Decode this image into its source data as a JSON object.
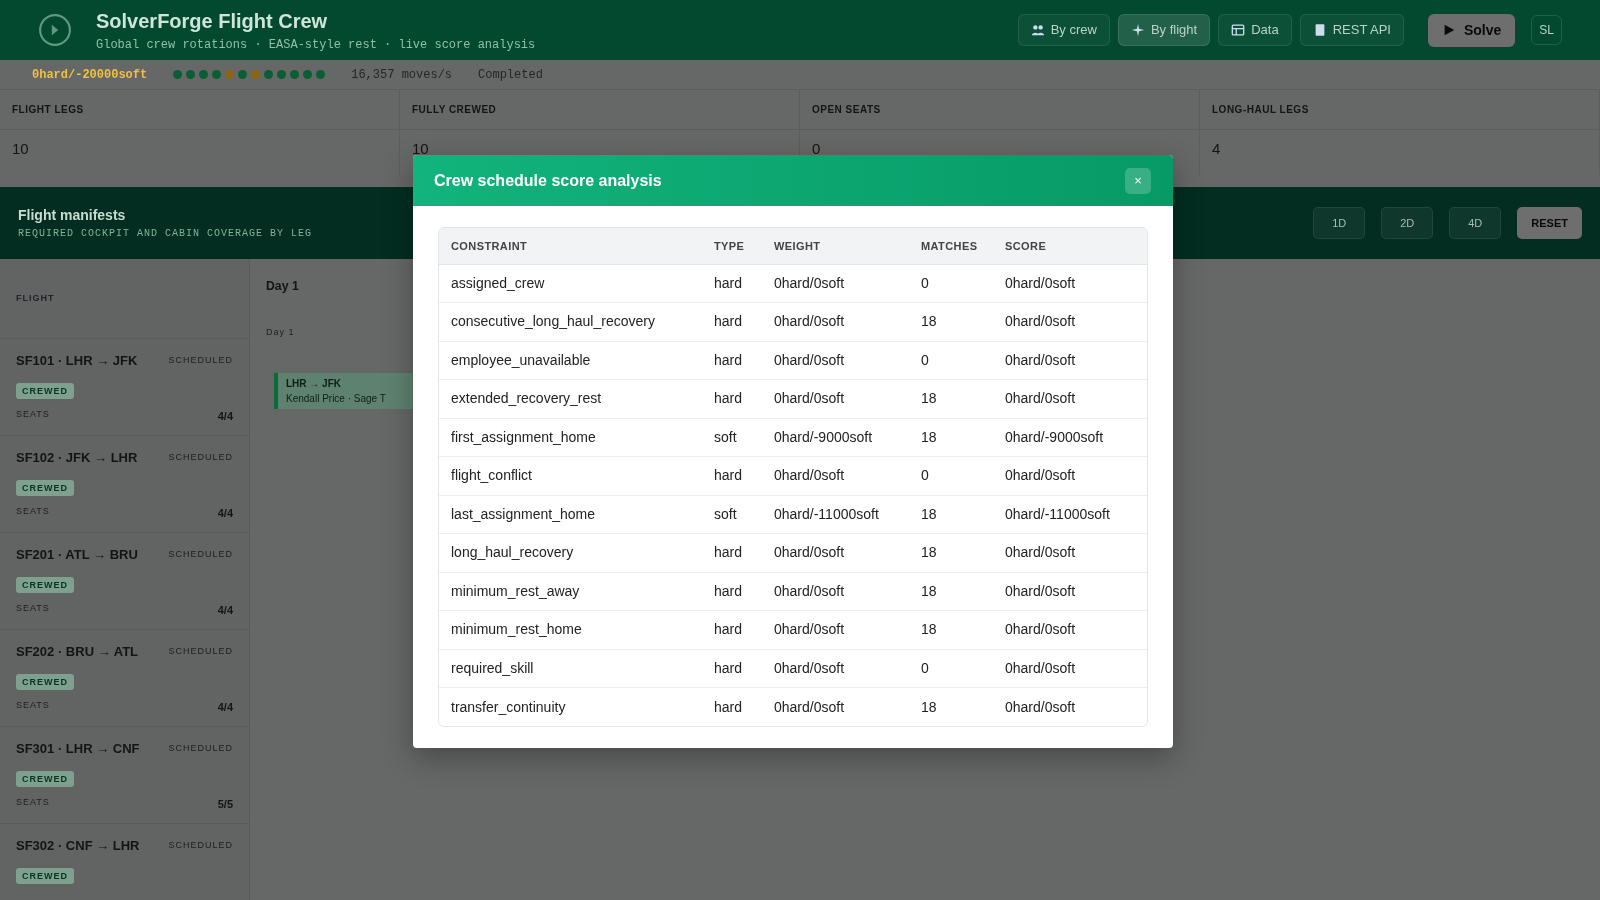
{
  "header": {
    "title": "SolverForge Flight Crew",
    "subtitle": "Global crew rotations · EASA-style rest · live score analysis",
    "nav": [
      {
        "kind": "crew",
        "label": "By crew",
        "selected": false
      },
      {
        "kind": "flight",
        "label": "By flight",
        "selected": true
      },
      {
        "kind": "data",
        "label": "Data",
        "selected": false
      },
      {
        "kind": "api",
        "label": "REST API",
        "selected": false
      }
    ],
    "solve_button": "Solve",
    "user_button": "SL"
  },
  "status": {
    "score": "0hard/-20000soft",
    "dots": [
      {
        "color": "#0b5e33"
      },
      {
        "color": "#0b5e33"
      },
      {
        "color": "#0b5e33"
      },
      {
        "color": "#0b5e33"
      },
      {
        "color": "#8a6512"
      },
      {
        "color": "#0b5e33"
      },
      {
        "color": "#8a6512"
      },
      {
        "color": "#0b5e33"
      },
      {
        "color": "#0b5e33"
      },
      {
        "color": "#0b5e33"
      },
      {
        "color": "#0b5e33"
      },
      {
        "color": "#0b5e33"
      }
    ],
    "speed": "16,357 moves/s",
    "state": "Completed"
  },
  "stats": [
    {
      "label": "FLIGHT LEGS",
      "value": "10"
    },
    {
      "label": "FULLY CREWED",
      "value": "10"
    },
    {
      "label": "OPEN SEATS",
      "value": "0"
    },
    {
      "label": "LONG-HAUL LEGS",
      "value": "4"
    }
  ],
  "manifest": {
    "title": "Flight manifests",
    "subtitle": "REQUIRED COCKPIT AND CABIN COVERAGE BY LEG",
    "zoom_buttons": [
      "1D",
      "2D",
      "4D"
    ],
    "reset": "RESET",
    "column_header": "FLIGHT",
    "day_header": "Day 1",
    "day_sub": "Day 1",
    "flights": [
      {
        "code": "SF101 · LHR → JFK",
        "status": "SCHEDULED",
        "badge": "CREWED",
        "seats_label": "SEATS",
        "seats": "4/4"
      },
      {
        "code": "SF102 · JFK → LHR",
        "status": "SCHEDULED",
        "badge": "CREWED",
        "seats_label": "SEATS",
        "seats": "4/4"
      },
      {
        "code": "SF201 · ATL → BRU",
        "status": "SCHEDULED",
        "badge": "CREWED",
        "seats_label": "SEATS",
        "seats": "4/4"
      },
      {
        "code": "SF202 · BRU → ATL",
        "status": "SCHEDULED",
        "badge": "CREWED",
        "seats_label": "SEATS",
        "seats": "4/4"
      },
      {
        "code": "SF301 · LHR → CNF",
        "status": "SCHEDULED",
        "badge": "CREWED",
        "seats_label": "SEATS",
        "seats": "5/5"
      },
      {
        "code": "SF302 · CNF → LHR",
        "status": "SCHEDULED",
        "badge": "CREWED"
      }
    ],
    "bar": {
      "route": "LHR → JFK",
      "crew": "Kendall Price · Sage T"
    }
  },
  "modal": {
    "title": "Crew schedule score analysis",
    "close": "×",
    "columns": [
      "CONSTRAINT",
      "TYPE",
      "WEIGHT",
      "MATCHES",
      "SCORE"
    ],
    "rows": [
      [
        "assigned_crew",
        "hard",
        "0hard/0soft",
        "0",
        "0hard/0soft"
      ],
      [
        "consecutive_long_haul_recovery",
        "hard",
        "0hard/0soft",
        "18",
        "0hard/0soft"
      ],
      [
        "employee_unavailable",
        "hard",
        "0hard/0soft",
        "0",
        "0hard/0soft"
      ],
      [
        "extended_recovery_rest",
        "hard",
        "0hard/0soft",
        "18",
        "0hard/0soft"
      ],
      [
        "first_assignment_home",
        "soft",
        "0hard/-9000soft",
        "18",
        "0hard/-9000soft"
      ],
      [
        "flight_conflict",
        "hard",
        "0hard/0soft",
        "0",
        "0hard/0soft"
      ],
      [
        "last_assignment_home",
        "soft",
        "0hard/-11000soft",
        "18",
        "0hard/-11000soft"
      ],
      [
        "long_haul_recovery",
        "hard",
        "0hard/0soft",
        "18",
        "0hard/0soft"
      ],
      [
        "minimum_rest_away",
        "hard",
        "0hard/0soft",
        "18",
        "0hard/0soft"
      ],
      [
        "minimum_rest_home",
        "hard",
        "0hard/0soft",
        "18",
        "0hard/0soft"
      ],
      [
        "required_skill",
        "hard",
        "0hard/0soft",
        "0",
        "0hard/0soft"
      ],
      [
        "transfer_continuity",
        "hard",
        "0hard/0soft",
        "18",
        "0hard/0soft"
      ]
    ]
  }
}
